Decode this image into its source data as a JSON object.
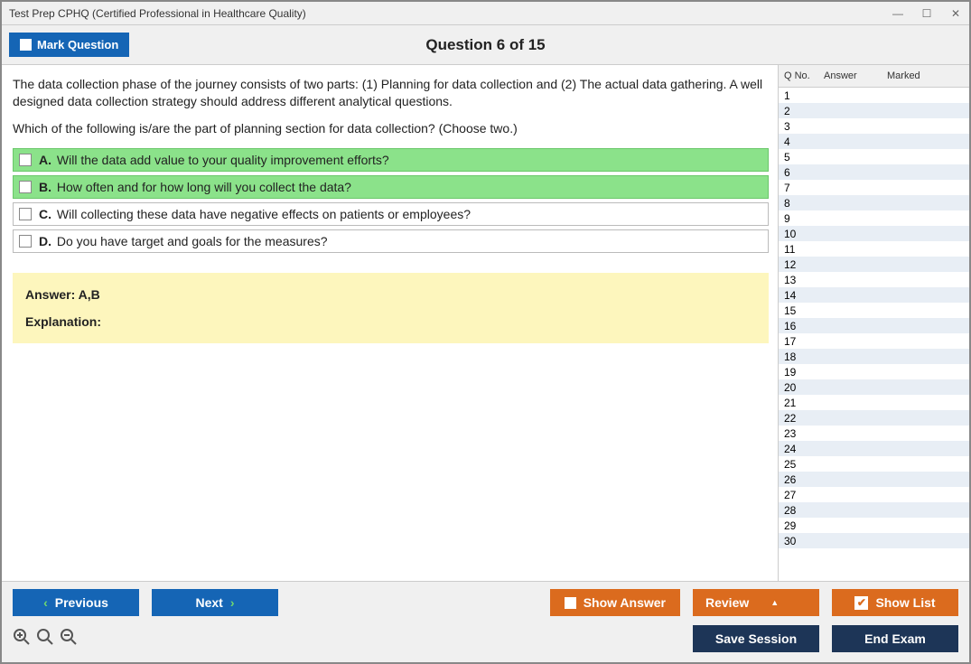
{
  "window": {
    "title": "Test Prep CPHQ (Certified Professional in Healthcare Quality)"
  },
  "header": {
    "mark_label": "Mark Question",
    "question_num": "Question 6 of 15"
  },
  "question": {
    "text": "The data collection phase of the journey consists of two parts: (1) Planning for data collection and (2) The actual data gathering. A well designed data collection strategy should address different analytical questions.",
    "prompt": "Which of the following is/are the part of planning section for data collection? (Choose two.)",
    "options": [
      {
        "letter": "A.",
        "text": "Will the data add value to your quality improvement efforts?",
        "correct": true
      },
      {
        "letter": "B.",
        "text": "How often and for how long will you collect the data?",
        "correct": true
      },
      {
        "letter": "C.",
        "text": "Will collecting these data have negative effects on patients or employees?",
        "correct": false
      },
      {
        "letter": "D.",
        "text": "Do you have target and goals for the measures?",
        "correct": false
      }
    ]
  },
  "answer": {
    "line": "Answer: A,B",
    "explanation_label": "Explanation:"
  },
  "side": {
    "cols": {
      "qno": "Q No.",
      "answer": "Answer",
      "marked": "Marked"
    },
    "rows": [
      1,
      2,
      3,
      4,
      5,
      6,
      7,
      8,
      9,
      10,
      11,
      12,
      13,
      14,
      15,
      16,
      17,
      18,
      19,
      20,
      21,
      22,
      23,
      24,
      25,
      26,
      27,
      28,
      29,
      30
    ]
  },
  "footer": {
    "previous": "Previous",
    "next": "Next",
    "show_answer": "Show Answer",
    "review": "Review",
    "show_list": "Show List",
    "save_session": "Save Session",
    "end_exam": "End Exam"
  }
}
